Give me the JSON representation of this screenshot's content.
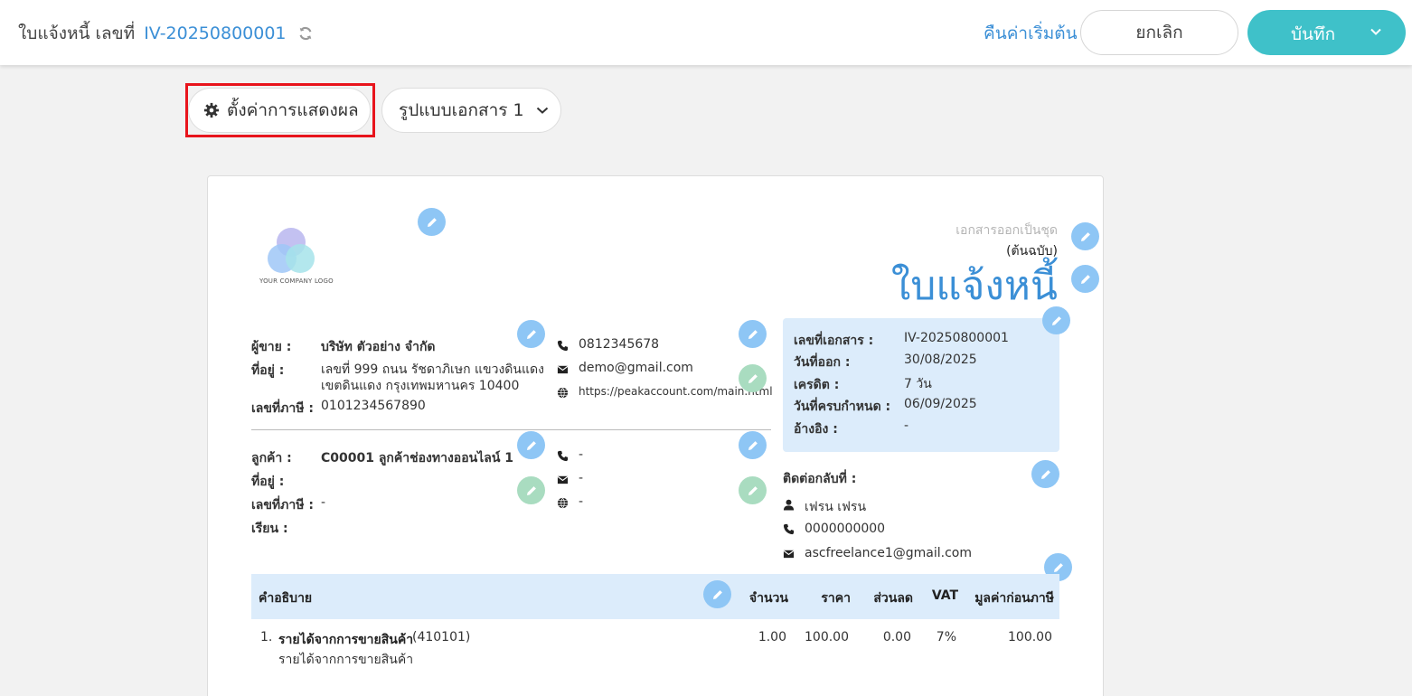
{
  "header": {
    "title_prefix": "ใบแจ้งหนี้ เลขที่",
    "doc_number": "IV-20250800001",
    "reset_label": "คืนค่าเริ่มต้น",
    "cancel_label": "ยกเลิก",
    "save_label": "บันทึก"
  },
  "toolbar": {
    "display_settings_label": "ตั้งค่าการแสดงผล",
    "format_label": "รูปแบบเอกสาร 1"
  },
  "document": {
    "logo_text": "YOUR COMPANY LOGO",
    "doc_set_label": "เอกสารออกเป็นชุด",
    "original_label": "(ต้นฉบับ)",
    "title": "ใบแจ้งหนี้",
    "seller": {
      "seller_label": "ผู้ขาย :",
      "seller_value": "บริษัท ตัวอย่าง จำกัด",
      "address_label": "ที่อยู่ :",
      "address_line1": "เลขที่ 999 ถนน รัชดาภิเษก แขวงดินแดง",
      "address_line2": "เขตดินแดง กรุงเทพมหานคร 10400",
      "tax_label": "เลขที่ภาษี :",
      "tax_value": "0101234567890",
      "phone": "0812345678",
      "email": "demo@gmail.com",
      "website": "https://peakaccount.com/main.html"
    },
    "customer": {
      "customer_label": "ลูกค้า :",
      "customer_value": "C00001 ลูกค้าช่องทางออนไลน์ 1",
      "address_label": "ที่อยู่ :",
      "tax_label": "เลขที่ภาษี :",
      "tax_value": "-",
      "attn_label": "เรียน :",
      "phone": "-",
      "email": "-",
      "website": "-"
    },
    "info": {
      "doc_no_label": "เลขที่เอกสาร :",
      "doc_no_value": "IV-20250800001",
      "issue_label": "วันที่ออก :",
      "issue_value": "30/08/2025",
      "credit_label": "เครดิต :",
      "credit_value": "7 วัน",
      "due_label": "วันที่ครบกำหนด :",
      "due_value": "06/09/2025",
      "ref_label": "อ้างอิง :",
      "ref_value": "-"
    },
    "contact": {
      "label": "ติดต่อกลับที่ :",
      "name": "เฟรน เฟรน",
      "phone": "0000000000",
      "email": "ascfreelance1@gmail.com"
    },
    "table": {
      "headers": {
        "description": "คำอธิบาย",
        "qty": "จำนวน",
        "price": "ราคา",
        "discount": "ส่วนลด",
        "vat": "VAT",
        "amount": "มูลค่าก่อนภาษี"
      },
      "rows": [
        {
          "no": "1.",
          "name": "รายได้จากการขายสินค้า",
          "code": "(410101)",
          "subdesc": "รายได้จากการขายสินค้า",
          "qty": "1.00",
          "price": "100.00",
          "discount": "0.00",
          "vat": "7%",
          "amount": "100.00"
        }
      ]
    }
  },
  "colors": {
    "accent": "#3b8fd6",
    "save_button": "#3fc1c9",
    "info_box": "#dcecfb",
    "highlight": "#e8141c",
    "pen_blue": "#8ec6f5",
    "pen_green": "#a9dcc0"
  },
  "icons": [
    "refresh-icon",
    "chevron-down-icon",
    "gear-icon",
    "pencil-icon",
    "phone-icon",
    "mail-icon",
    "globe-icon",
    "user-icon"
  ]
}
